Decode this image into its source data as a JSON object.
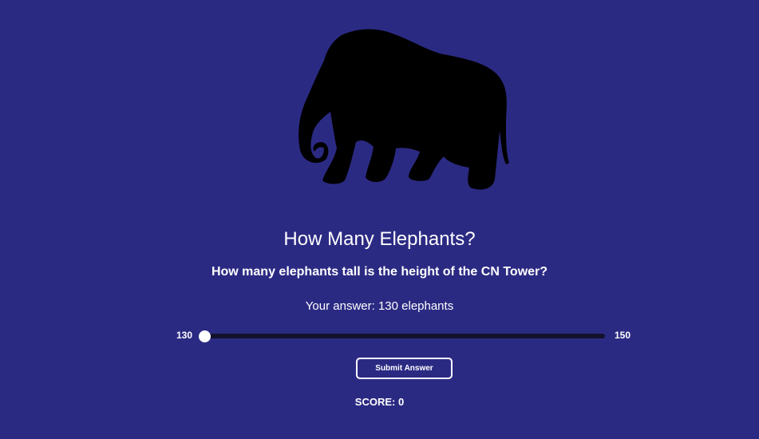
{
  "game": {
    "image_icon": "elephant-silhouette-icon",
    "title": "How Many Elephants?",
    "question": "How many elephants tall is the height of the CN Tower?",
    "answer_text": "Your answer: 130 elephants",
    "slider": {
      "min_label": "130",
      "max_label": "150",
      "min": 130,
      "max": 150,
      "value": 130
    },
    "submit_label": "Submit Answer",
    "score_text": "SCORE: 0"
  },
  "colors": {
    "background": "#2b2a83",
    "text": "#ffffff",
    "track": "#12122e",
    "silhouette": "#000000"
  }
}
